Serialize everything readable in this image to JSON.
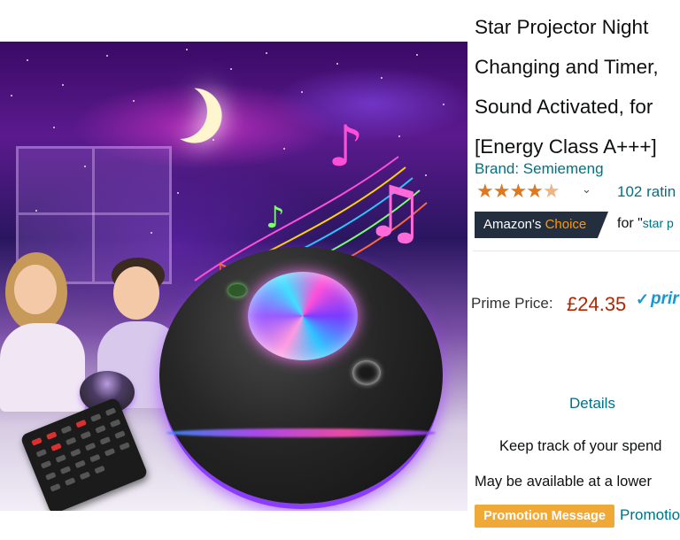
{
  "product": {
    "title_lines": [
      "Star Projector Night",
      "Changing and Timer,",
      "Sound Activated, for",
      "[Energy Class A+++]"
    ],
    "brand": "Brand: Semiemeng",
    "rating_stars": "★★★★",
    "rating_half_star": "★",
    "rating_chevron": "⌄",
    "ratings_count": "102 ratin",
    "badge": {
      "prefix": "Amazon's ",
      "highlight": "Choice"
    },
    "choice_for_prefix": "for \"",
    "choice_for_query": "star p",
    "price_label": "Prime Price:",
    "price": "£24.35",
    "prime_check": "✓",
    "prime_text": "prir",
    "details_label": "Details",
    "keep_track": "Keep track of your spend",
    "availability": "May be available at a lower",
    "promotion_badge": "Promotion Message",
    "promotions_link": "Promotio"
  },
  "colors": {
    "link": "#007185",
    "price": "#b12704",
    "star": "#de7921",
    "badge_bg": "#232f3e",
    "badge_accent": "#ff9900",
    "prime": "#1399d3",
    "promotion": "#f0a837"
  },
  "image": {
    "icons": [
      "moon-icon",
      "music-notes-graphic",
      "projector-device",
      "remote-control"
    ]
  }
}
